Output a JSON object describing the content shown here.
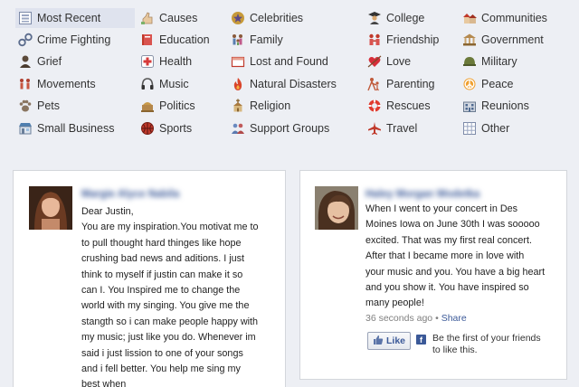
{
  "categories": [
    {
      "label": "Most Recent",
      "icon": "📋"
    },
    {
      "label": "Crime Fighting",
      "icon": "🔗"
    },
    {
      "label": "Grief",
      "icon": "👤"
    },
    {
      "label": "Movements",
      "icon": "👥"
    },
    {
      "label": "Pets",
      "icon": "🐾"
    },
    {
      "label": "Small Business",
      "icon": "🏪"
    },
    {
      "label": "Causes",
      "icon": "✋"
    },
    {
      "label": "Education",
      "icon": "📕"
    },
    {
      "label": "Health",
      "icon": "➕"
    },
    {
      "label": "Music",
      "icon": "🎧"
    },
    {
      "label": "Politics",
      "icon": "🏛"
    },
    {
      "label": "Sports",
      "icon": "🏀"
    },
    {
      "label": "Celebrities",
      "icon": "⭐"
    },
    {
      "label": "Family",
      "icon": "👪"
    },
    {
      "label": "Lost and Found",
      "icon": "📦"
    },
    {
      "label": "Natural Disasters",
      "icon": "🔥"
    },
    {
      "label": "Religion",
      "icon": "⛪"
    },
    {
      "label": "Support Groups",
      "icon": "👥"
    },
    {
      "label": "College",
      "icon": "🎓"
    },
    {
      "label": "Friendship",
      "icon": "👫"
    },
    {
      "label": "Love",
      "icon": "💘"
    },
    {
      "label": "Parenting",
      "icon": "🤸"
    },
    {
      "label": "Rescues",
      "icon": "⭕"
    },
    {
      "label": "Travel",
      "icon": "✈"
    },
    {
      "label": "Communities",
      "icon": "🏘"
    },
    {
      "label": "Government",
      "icon": "🏛"
    },
    {
      "label": "Military",
      "icon": "🪖"
    },
    {
      "label": "Peace",
      "icon": "☮"
    },
    {
      "label": "Reunions",
      "icon": "🏫"
    },
    {
      "label": "Other",
      "icon": "▦"
    }
  ],
  "selected_category": "Most Recent",
  "posts": [
    {
      "author": "Margie Alyce Nabila",
      "lines": [
        "Dear Justin,",
        "You are my inspiration.You motivat me to",
        "to pull thought hard thinges like hope",
        "crushing bad news and aditions. I just",
        "think to myself if justin can make it so",
        "can I. You Inspired me to change the",
        "world with my singing. You give me the",
        "stangth so i can make people happy with",
        "my music; just like you do. Whenever im",
        "said i just lission to one of your songs",
        "and i fell better. You help me sing my",
        "best when"
      ]
    },
    {
      "author": "Haley Morgan Wodetka",
      "lines": [
        "When I went to your concert in Des",
        "Moines Iowa on June 30th I was sooooo",
        "excited. That was my first real concert.",
        "After that I became more in love with",
        "your music and you. You have a big heart",
        "and you show it. You have inspired so",
        "many people!"
      ],
      "time": "36 seconds ago",
      "separator": "•",
      "share": "Share",
      "like_button": "Like",
      "like_prompt_line1": "Be the first of your friends",
      "like_prompt_line2": "to like this."
    }
  ]
}
